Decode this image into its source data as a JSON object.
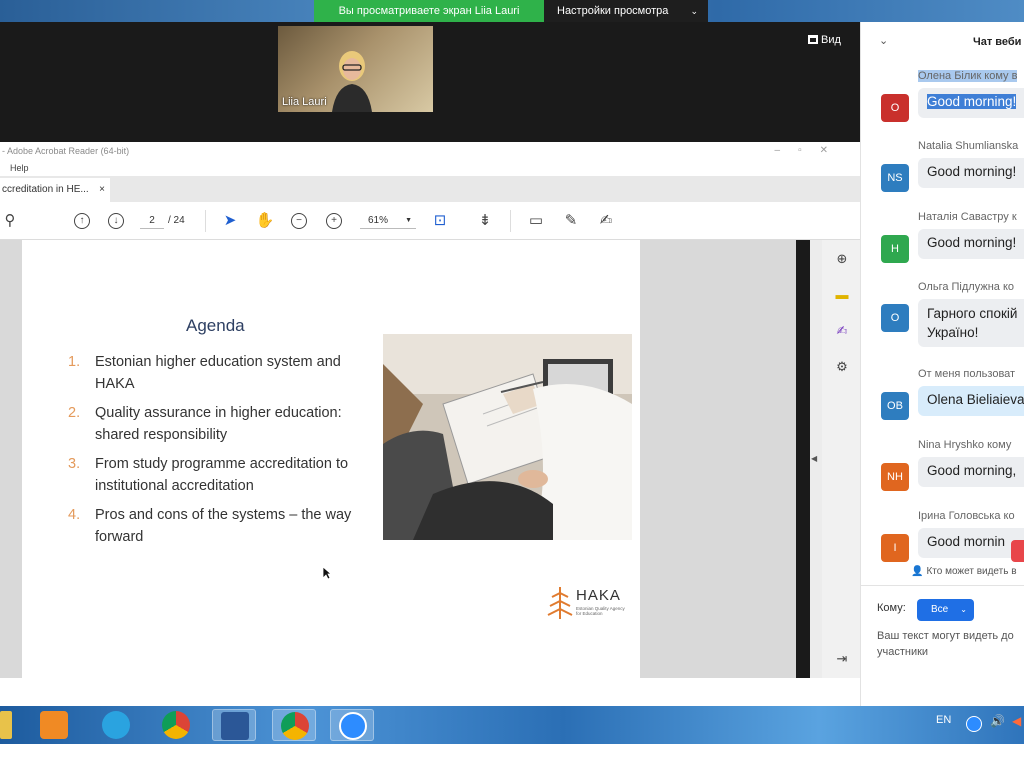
{
  "zoom": {
    "share_banner": "Вы просматриваете экран Liia Lauri",
    "view_settings_label": "Настройки просмотра",
    "participant_name": "Liia Lauri",
    "view_button_label": "Вид"
  },
  "acrobat": {
    "window_title": "- Adobe Acrobat Reader (64-bit)",
    "menu_help": "Help",
    "tab_label": "ccreditation in HE...",
    "tab_close": "×",
    "page_current": "2",
    "page_total": "/ 24",
    "zoom_level": "61%"
  },
  "slide": {
    "title": "Agenda",
    "items": [
      {
        "num": "1.",
        "text": "Estonian higher education system and HAKA"
      },
      {
        "num": "2.",
        "text": "Quality assurance in  higher education: shared responsibility"
      },
      {
        "num": "3.",
        "text": "From study programme accreditation to institutional accreditation"
      },
      {
        "num": "4.",
        "text": "Pros and cons of the systems – the way forward"
      }
    ],
    "logo_text": "HAKA",
    "logo_subtitle": "Estonian Quality Agency for Education"
  },
  "chat": {
    "title": "Чат веби",
    "messages": [
      {
        "initials": "O",
        "color": "#c9302c",
        "sender": "Олена Білик кому в",
        "text": "Good morning!"
      },
      {
        "initials": "NS",
        "color": "#2e7dbf",
        "sender": "Natalia Shumlianska",
        "text": "Good morning!"
      },
      {
        "initials": "Н",
        "color": "#2fa84f",
        "sender": "Наталія Савастру к",
        "text": "Good morning!"
      },
      {
        "initials": "О",
        "color": "#2e7dbf",
        "sender": "Ольга Підлужна ко",
        "text": "Гарного спокій Україно!"
      },
      {
        "initials": "OB",
        "color": "#2e7dbf",
        "sender": "От меня пользоват",
        "text": "Olena Bieliaieva"
      },
      {
        "initials": "NH",
        "color": "#e0661f",
        "sender": "Nina Hryshko кому",
        "text": "Good morning,"
      },
      {
        "initials": "I",
        "color": "#e0661f",
        "sender": "Ірина Головська ко",
        "text": "Good mornin"
      }
    ],
    "who_can_see": "Кто может видеть в",
    "to_label": "Кому:",
    "to_value": "Все",
    "input_placeholder": "Ваш текст могут видеть до участники"
  },
  "taskbar": {
    "language": "EN"
  }
}
